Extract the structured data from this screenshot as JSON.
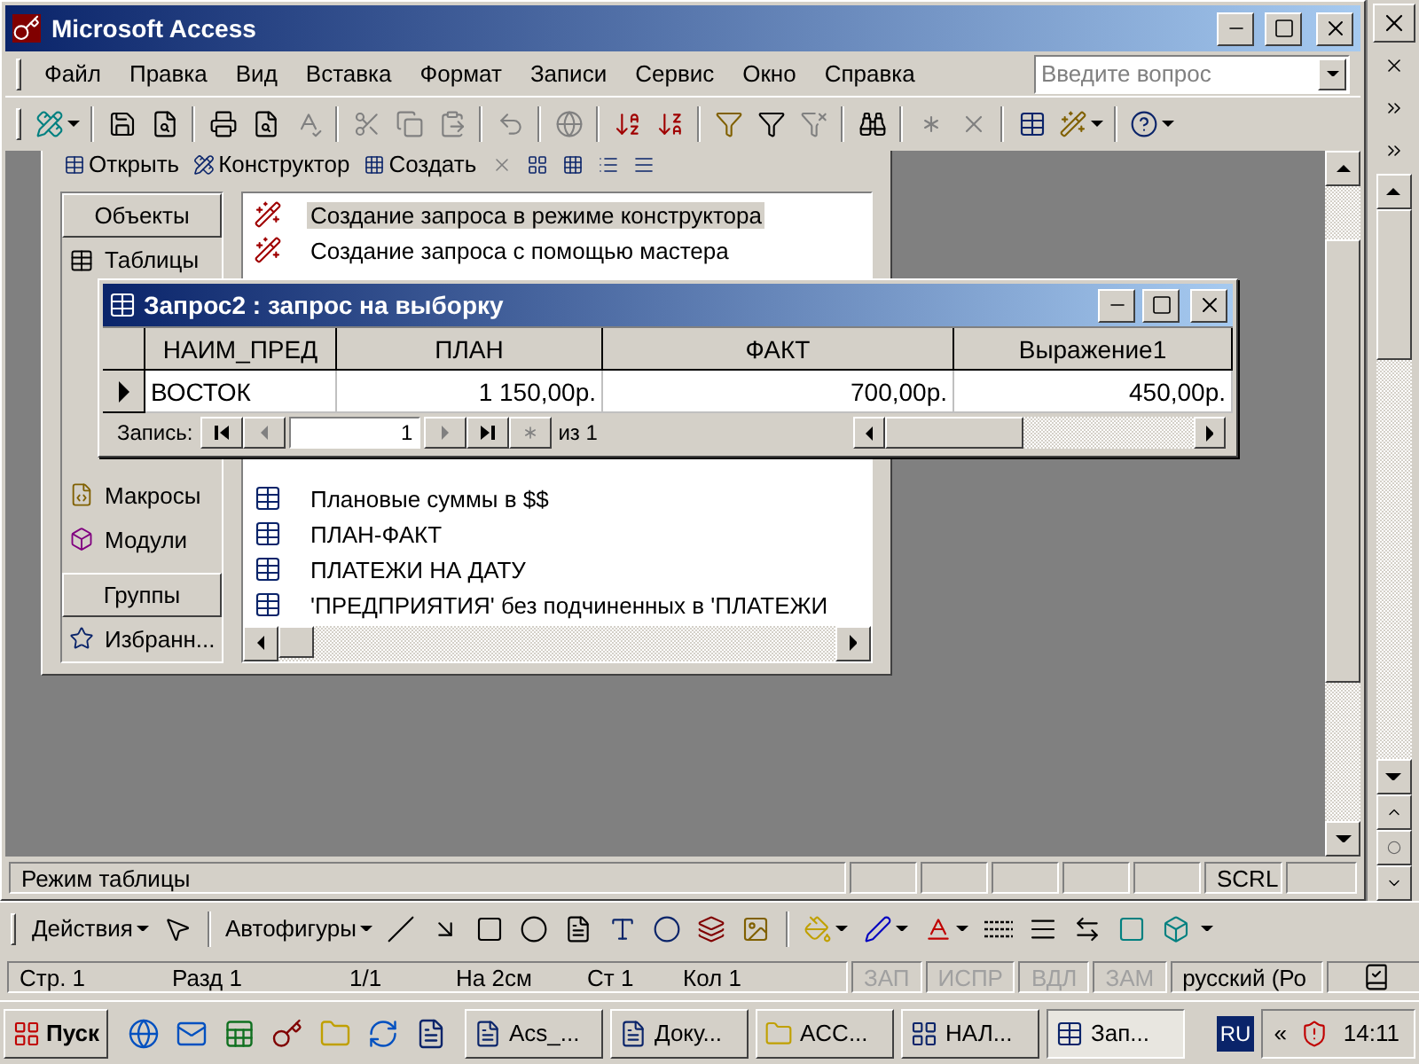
{
  "window": {
    "title": "Microsoft Access"
  },
  "menu": [
    "Файл",
    "Правка",
    "Вид",
    "Вставка",
    "Формат",
    "Записи",
    "Сервис",
    "Окно",
    "Справка"
  ],
  "help_search": {
    "placeholder": "Введите вопрос"
  },
  "db_window": {
    "toolbar": [
      "Открыть",
      "Конструктор",
      "Создать"
    ],
    "objects_header": "Объекты",
    "objects_top": [
      {
        "label": "Таблицы",
        "selected": false
      }
    ],
    "objects_bottom": [
      {
        "label": "Макросы",
        "selected": false
      },
      {
        "label": "Модули",
        "selected": false
      }
    ],
    "groups_header": "Группы",
    "groups": [
      "Избранн..."
    ],
    "list_top": [
      {
        "label": "Создание запроса в режиме конструктора",
        "kind": "wizard",
        "selected": true
      },
      {
        "label": "Создание запроса с помощью мастера",
        "kind": "wizard",
        "selected": false
      }
    ],
    "list_bottom": [
      {
        "label": "Плановые суммы в $$",
        "kind": "query",
        "selected": false
      },
      {
        "label": "ПЛАН-ФАКТ",
        "kind": "query",
        "selected": false
      },
      {
        "label": "ПЛАТЕЖИ НА ДАТУ",
        "kind": "query",
        "selected": false
      },
      {
        "label": "'ПРЕДПРИЯТИЯ' без подчиненных в 'ПЛАТЕЖИ",
        "kind": "query",
        "selected": false
      }
    ]
  },
  "query_window": {
    "title": "Запрос2 : запрос на выборку",
    "columns": [
      "НАИМ_ПРЕД",
      "ПЛАН",
      "ФАКТ",
      "Выражение1"
    ],
    "rows": [
      {
        "current": true,
        "cells": [
          "ВОСТОК",
          "1 150,00р.",
          "700,00р.",
          "450,00р."
        ]
      }
    ],
    "nav": {
      "label": "Запись:",
      "record": "1",
      "total": "из 1"
    }
  },
  "status_bar": {
    "mode": "Режим таблицы",
    "indicator": "SCRL"
  },
  "word_toolbar": {
    "actions": "Действия",
    "autoshapes": "Автофигуры"
  },
  "word_status": {
    "fields": [
      "Стр. 1",
      "Разд 1",
      "1/1",
      "На 2см",
      "Ст 1",
      "Кол 1"
    ],
    "indicators": [
      {
        "label": "ЗАП",
        "disabled": true
      },
      {
        "label": "ИСПР",
        "disabled": true
      },
      {
        "label": "ВДЛ",
        "disabled": true
      },
      {
        "label": "ЗАМ",
        "disabled": true
      }
    ],
    "language": "русский (Ро"
  },
  "taskbar": {
    "start": "Пуск",
    "tasks": [
      {
        "label": "Acs_...",
        "kind": "word",
        "selected": false
      },
      {
        "label": "Доку...",
        "kind": "word",
        "selected": false
      },
      {
        "label": "ACC...",
        "kind": "folder",
        "selected": false
      },
      {
        "label": "НАЛ...",
        "kind": "access",
        "selected": false
      },
      {
        "label": "Зап...",
        "kind": "query",
        "selected": true
      }
    ],
    "language": "RU",
    "tray_expand": "«",
    "clock": "14:11"
  }
}
